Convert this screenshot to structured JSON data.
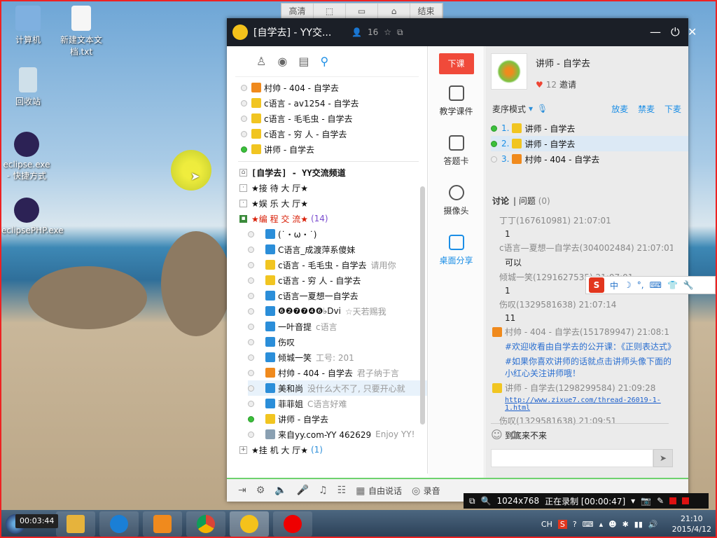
{
  "desktop": {
    "icons": [
      {
        "label": "计算机",
        "icon": "computer-icon"
      },
      {
        "label": "新建文本文档.txt",
        "icon": "text-file-icon"
      },
      {
        "label": "回收站",
        "icon": "recycle-bin-icon"
      },
      {
        "label": "eclipse.exe - 快捷方式",
        "icon": "eclipse-shortcut-icon"
      },
      {
        "label": "eclipsePHP.exe",
        "icon": "eclipse-shortcut-icon"
      }
    ]
  },
  "topbar": [
    "高清",
    "",
    "",
    "",
    "结束"
  ],
  "yy": {
    "title": "[自学去] - YY交...",
    "member_count": "16",
    "tabs_icons": [
      "contacts-icon",
      "location-icon",
      "notes-icon",
      "search-icon"
    ],
    "mic_list": [
      {
        "name": "村帅 - 404 - 自学去",
        "online": false,
        "badge": "orange"
      },
      {
        "name": "c语言 - av1254 - 自学去",
        "online": false,
        "badge": "yellow"
      },
      {
        "name": "c语言 - 毛毛虫 - 自学去",
        "online": false,
        "badge": "yellow"
      },
      {
        "name": "c语言 - 穷 人 - 自学去",
        "online": false,
        "badge": "yellow"
      },
      {
        "name": "讲师 - 自学去",
        "online": true,
        "badge": "yellow"
      }
    ],
    "channel_title": "[自学去] - YY交流频道",
    "channels": [
      {
        "name": "★接 待 大 厅★",
        "count": ""
      },
      {
        "name": "★娱 乐 大 厅★",
        "count": ""
      },
      {
        "name": "★编 程 交 流★",
        "count": "(14)"
      }
    ],
    "members": [
      {
        "name": "(˙・ω・˙)",
        "note": "",
        "badge": "blue"
      },
      {
        "name": "C语言_成渡萍系傻妹",
        "note": "",
        "badge": "blue"
      },
      {
        "name": "c语言 - 毛毛虫 - 自学去",
        "note": "请用你",
        "badge": "yellow"
      },
      {
        "name": "c语言 - 穷 人 - 自学去",
        "note": "",
        "badge": "yellow"
      },
      {
        "name": "c语言一夏想一自学去",
        "note": "",
        "badge": "blue"
      },
      {
        "name": "❻❷❼❼❹❻♭Dvi",
        "note": "☆天若赐我",
        "badge": "blue"
      },
      {
        "name": "一叶音提",
        "note": "c语言",
        "badge": "blue"
      },
      {
        "name": "伤叹",
        "note": "",
        "badge": "blue"
      },
      {
        "name": "倾城一笑",
        "note": "工号: 201",
        "badge": "blue"
      },
      {
        "name": "村帅 - 404 - 自学去",
        "note": "君子纳于言",
        "badge": "orange"
      },
      {
        "name": "美和尚",
        "note": "没什么大不了, 只要开心就",
        "badge": "blue"
      },
      {
        "name": "菲菲姐",
        "note": "C语言好难",
        "badge": "blue"
      },
      {
        "name": "讲师 - 自学去",
        "note": "",
        "badge": "yellow"
      },
      {
        "name": "来自yy.com-YY 462629",
        "note": "Enjoy YY!",
        "badge": "gray"
      }
    ],
    "hang_channel": {
      "name": "★挂 机 大 厅★",
      "count": "(1)"
    },
    "bottom": {
      "free_talk": "自由说话",
      "record": "录音"
    },
    "tools": {
      "end_class": "下课",
      "items": [
        "教学课件",
        "答题卡",
        "摄像头",
        "桌面分享"
      ]
    },
    "teacher": {
      "name": "讲师 - 自学去",
      "likes": "12",
      "invite": "邀请"
    },
    "mode": {
      "label": "麦序模式",
      "actions": [
        "放麦",
        "禁麦",
        "下麦"
      ]
    },
    "queue": [
      {
        "num": "1.",
        "name": "讲师 - 自学去"
      },
      {
        "num": "2.",
        "name": "讲师 - 自学去"
      },
      {
        "num": "3.",
        "name": "村帅 - 404 - 自学去"
      }
    ],
    "discussion": {
      "tab1": "讨论",
      "tab2": "问题",
      "tab2_count": "(0)",
      "messages": [
        {
          "head": "丁丁(167610981) 21:07:01",
          "body": "1"
        },
        {
          "head": "c语言—夏想—自学去(304002484) 21:07:01",
          "body": "可以"
        },
        {
          "head": "倾城一笑(1291627535) 21:07:01",
          "body": "1"
        },
        {
          "head": "伤叹(1329581638) 21:07:14",
          "body": "11"
        },
        {
          "head": "村帅 - 404 - 自学去(151789947) 21:08:1",
          "body": "#欢迎收看由自学去的公开课：《正则表达式》"
        },
        {
          "head": "",
          "body": "#如果你喜欢讲师的话就点击讲师头像下面的小红心关注讲师哦！"
        },
        {
          "head": "讲师 - 自学去(1298299584) 21:09:28",
          "body": "http://www.zixue7.com/thread-26019-1-1.html"
        },
        {
          "head": "伤叹(1329581638) 21:09:51",
          "body": "到底来不来"
        }
      ]
    }
  },
  "sogou": {
    "logo": "S",
    "mode": "中"
  },
  "recorder": {
    "resolution": "1024x768",
    "status": "正在录制 [00:00:47]"
  },
  "taskbar": {
    "timer": "00:03:44",
    "tray_lang": "CH",
    "time": "21:10",
    "date": "2015/4/12"
  }
}
